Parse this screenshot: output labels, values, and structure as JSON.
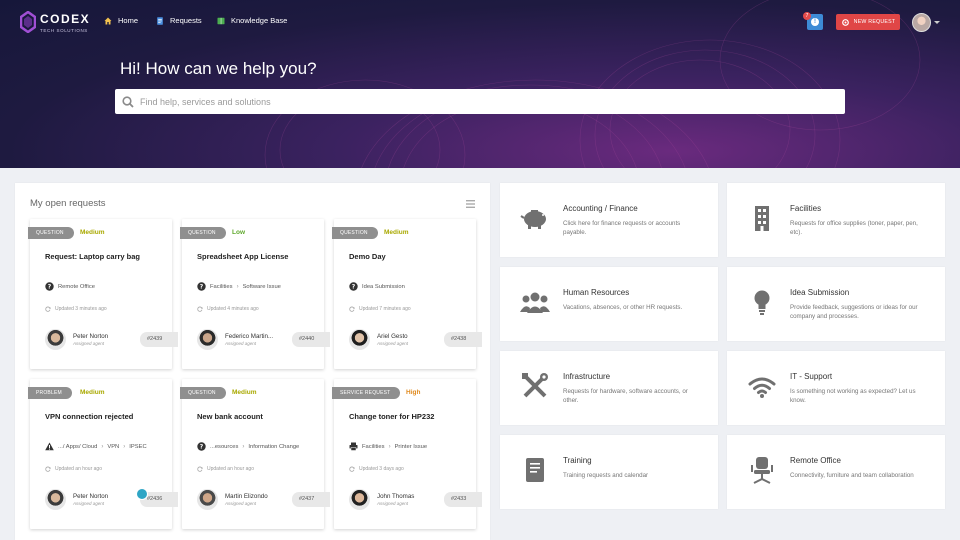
{
  "header": {
    "logo_name": "CODEX",
    "logo_tagline": "TECH SOLUTIONS",
    "nav": [
      {
        "label": "Home",
        "icon": "home-icon"
      },
      {
        "label": "Requests",
        "icon": "document-icon"
      },
      {
        "label": "Knowledge Base",
        "icon": "book-icon"
      }
    ],
    "alert_count": "7",
    "alert_symbol": "!",
    "new_request_label": "NEW REQUEST"
  },
  "hero": {
    "title": "Hi! How can we help you?",
    "search_placeholder": "Find help, services and solutions"
  },
  "open_requests": {
    "title": "My open requests",
    "cards": [
      {
        "type": "QUESTION",
        "priority": "Medium",
        "priority_color": "#a9a900",
        "title": "Request: Laptop carry bag",
        "category": [
          "Remote Office"
        ],
        "category_icon": "question-icon",
        "updated": "Updated 3 minutes ago",
        "agent": "Peter Norton",
        "agent_role": "Assigned agent",
        "ticket": "#2439"
      },
      {
        "type": "QUESTION",
        "priority": "Low",
        "priority_color": "#5ea82b",
        "title": "Spreadsheet App License",
        "category": [
          "Facilities",
          "Software Issue"
        ],
        "category_icon": "question-icon",
        "updated": "Updated 4 minutes ago",
        "agent": "Federico Martin...",
        "agent_role": "Assigned agent",
        "ticket": "#2440"
      },
      {
        "type": "QUESTION",
        "priority": "Medium",
        "priority_color": "#a9a900",
        "title": "Demo Day",
        "category": [
          "Idea Submission"
        ],
        "category_icon": "question-icon",
        "updated": "Updated 7 minutes ago",
        "agent": "Ariel Gesto",
        "agent_role": "Assigned agent",
        "ticket": "#2438"
      },
      {
        "type": "PROBLEM",
        "priority": "Medium",
        "priority_color": "#a9a900",
        "title": "VPN connection rejected",
        "category": [
          ".../ Apps/ Cloud",
          "VPN",
          "IPSEC"
        ],
        "category_icon": "warning-icon",
        "updated": "Updated an hour ago",
        "agent": "Peter Norton",
        "agent_role": "Assigned agent",
        "ticket": "#2436"
      },
      {
        "type": "QUESTION",
        "priority": "Medium",
        "priority_color": "#a9a900",
        "title": "New bank account",
        "category": [
          "...esources",
          "Information Change"
        ],
        "category_icon": "question-icon",
        "updated": "Updated an hour ago",
        "agent": "Martin Elizondo",
        "agent_role": "Assigned agent",
        "ticket": "#2437"
      },
      {
        "type": "SERVICE REQUEST",
        "priority": "High",
        "priority_color": "#e08a1e",
        "title": "Change toner for HP232",
        "category": [
          "Facilities",
          "Printer Issue"
        ],
        "category_icon": "printer-icon",
        "updated": "Updated 3 days ago",
        "agent": "John Thomas",
        "agent_role": "Assigned agent",
        "ticket": "#2433"
      }
    ]
  },
  "services": [
    {
      "title": "Accounting / Finance",
      "desc": "Click here for finance requests or accounts payable.",
      "icon": "piggy-bank-icon"
    },
    {
      "title": "Facilities",
      "desc": "Requests for office supplies (toner, paper, pen, etc).",
      "icon": "building-icon"
    },
    {
      "title": "Human Resources",
      "desc": "Vacations, absences, or other HR requests.",
      "icon": "people-icon"
    },
    {
      "title": "Idea Submission",
      "desc": "Provide feedback, suggestions or ideas for our company and processes.",
      "icon": "lightbulb-icon"
    },
    {
      "title": "Infrastructure",
      "desc": "Requests for hardware, software accounts, or other.",
      "icon": "tools-icon"
    },
    {
      "title": "IT - Support",
      "desc": "Is something not working as expected? Let us know.",
      "icon": "wifi-icon"
    },
    {
      "title": "Training",
      "desc": "Training requests and calendar",
      "icon": "book-icon"
    },
    {
      "title": "Remote Office",
      "desc": "Connectivity, furniture and team collaboration",
      "icon": "chair-icon"
    }
  ]
}
